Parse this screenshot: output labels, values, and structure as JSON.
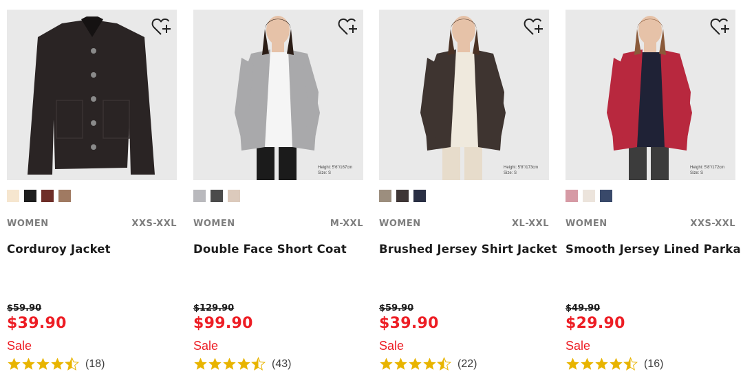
{
  "products": [
    {
      "name": "Corduroy Jacket",
      "category": "WOMEN",
      "sizes": "XXS-XXL",
      "original_price": "$59.90",
      "price": "$39.90",
      "sale_label": "Sale",
      "rating": 4.5,
      "review_count": "(18)",
      "model_info": [
        "",
        ""
      ],
      "colors": [
        "#f6e6cf",
        "#1e1e1e",
        "#6e2e28",
        "#a07a62"
      ],
      "garment_color": "#2a2424",
      "inner_color": "#2a2424",
      "image_bg": "#e9e9e9"
    },
    {
      "name": "Double Face Short Coat",
      "category": "WOMEN",
      "sizes": "M-XXL",
      "original_price": "$129.90",
      "price": "$99.90",
      "sale_label": "Sale",
      "rating": 4.5,
      "review_count": "(43)",
      "model_info": [
        "Height: 5'6\"/167cm",
        "Size: S"
      ],
      "colors": [
        "#b9b9bd",
        "#4b4b4b",
        "#dccabc"
      ],
      "garment_color": "#a9a9ab",
      "inner_color": "#f5f5f5",
      "image_bg": "#e9e9e9"
    },
    {
      "name": "Brushed Jersey Shirt Jacket",
      "category": "WOMEN",
      "sizes": "XL-XXL",
      "original_price": "$59.90",
      "price": "$39.90",
      "sale_label": "Sale",
      "rating": 4.5,
      "review_count": "(22)",
      "model_info": [
        "Height: 5'8\"/173cm",
        "Size: S"
      ],
      "colors": [
        "#9c8e7e",
        "#3e3636",
        "#2a2f44"
      ],
      "garment_color": "#3e3430",
      "inner_color": "#efe9dd",
      "image_bg": "#e9e9e9"
    },
    {
      "name": "Smooth Jersey Lined Parka",
      "category": "WOMEN",
      "sizes": "XXS-XXL",
      "original_price": "$49.90",
      "price": "$29.90",
      "sale_label": "Sale",
      "rating": 4.5,
      "review_count": "(16)",
      "model_info": [
        "Height: 5'8\"/172cm",
        "Size: S"
      ],
      "colors": [
        "#d69aa5",
        "#ece4dc",
        "#39496a"
      ],
      "garment_color": "#b8283e",
      "inner_color": "#1f2236",
      "image_bg": "#e9e9e9"
    }
  ],
  "icons": {
    "favorite": "heart-plus-icon",
    "star_full": "star-full-icon",
    "star_half": "star-half-icon"
  },
  "accent": {
    "sale_red": "#ed1d24",
    "star_gold": "#e8b400"
  }
}
